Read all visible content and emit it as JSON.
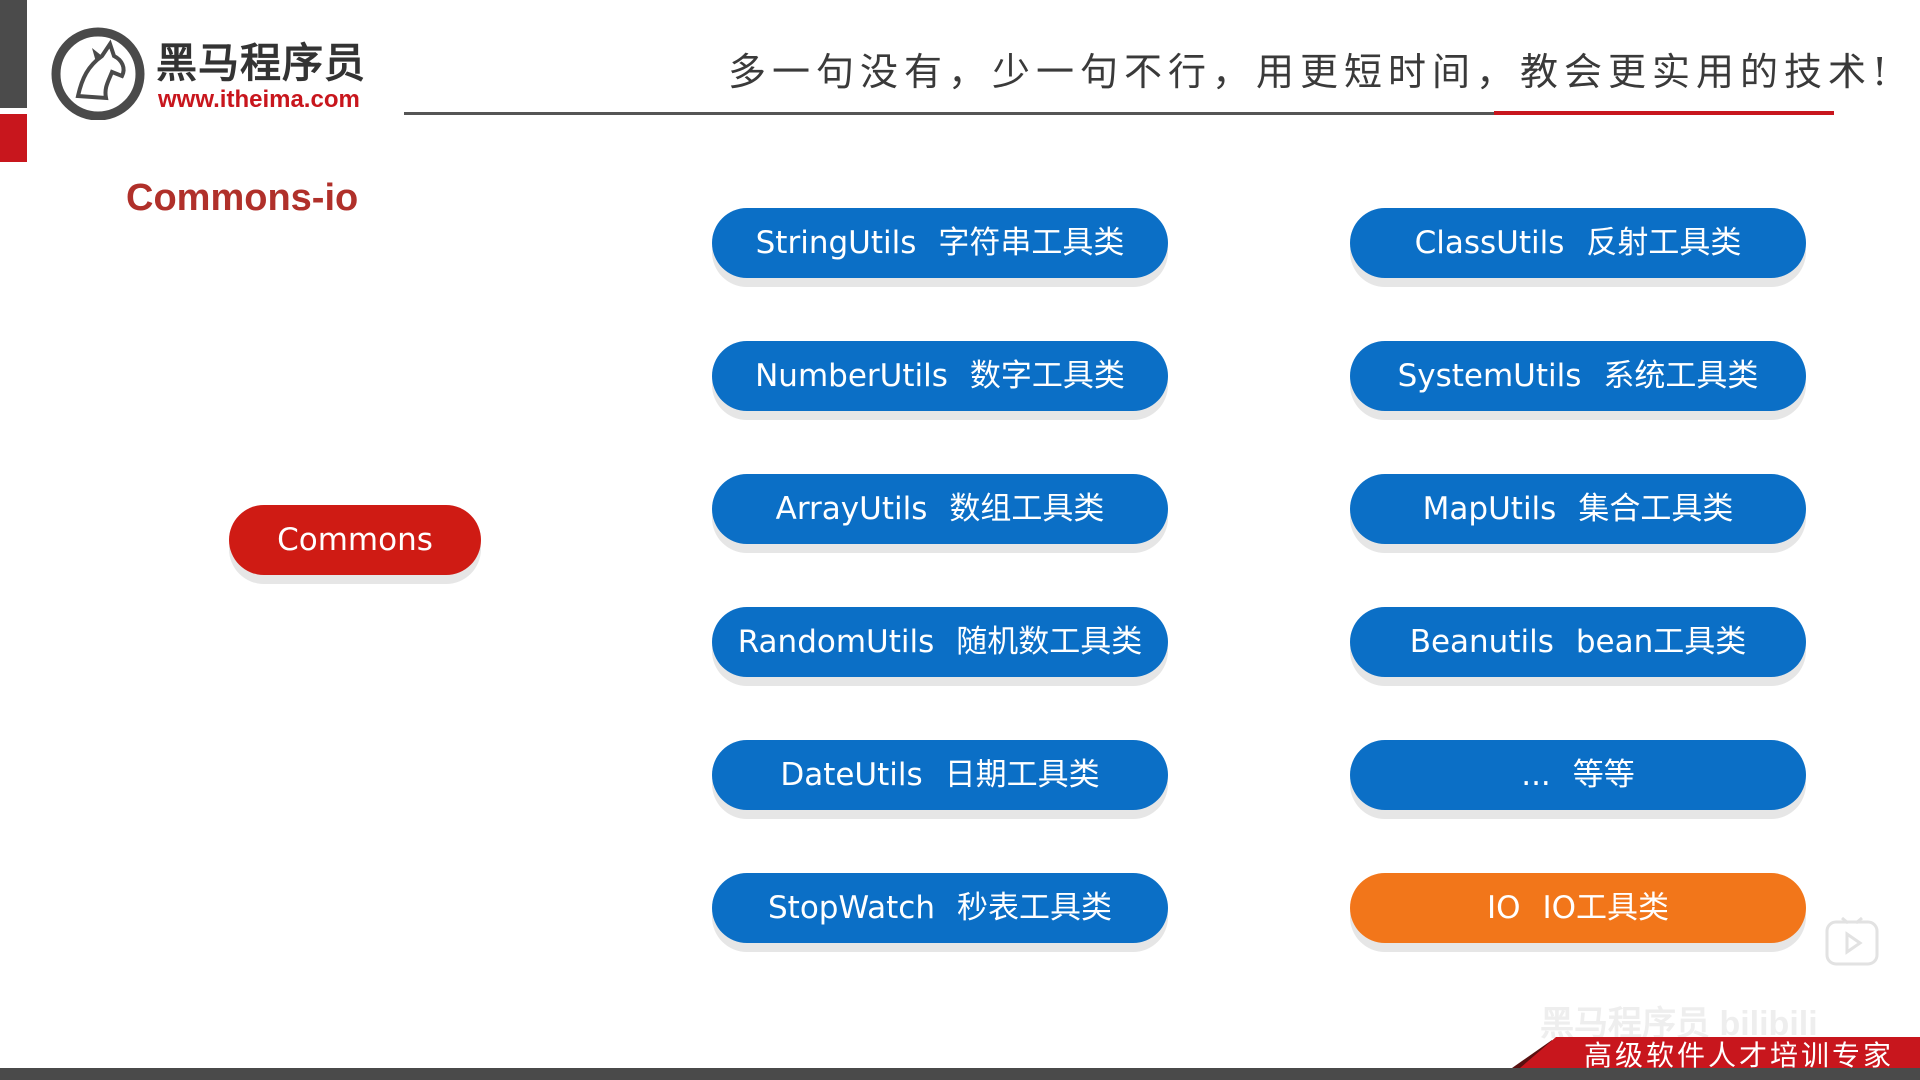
{
  "logo": {
    "name": "黑马程序员",
    "url": "www.itheima.com",
    "logo_icon": "horse-head-logo-icon"
  },
  "header": {
    "slogan": "多一句没有，少一句不行，用更短时间，教会更实用的技术!"
  },
  "page": {
    "title": "Commons-io"
  },
  "root_node": {
    "label": "Commons"
  },
  "left_column": [
    {
      "name": "StringUtils",
      "desc": "字符串工具类"
    },
    {
      "name": "NumberUtils",
      "desc": "数字工具类"
    },
    {
      "name": "ArrayUtils",
      "desc": "数组工具类"
    },
    {
      "name": "RandomUtils",
      "desc": "随机数工具类"
    },
    {
      "name": "DateUtils",
      "desc": "日期工具类"
    },
    {
      "name": "StopWatch",
      "desc": "秒表工具类"
    }
  ],
  "right_column": [
    {
      "name": "ClassUtils",
      "desc": "反射工具类"
    },
    {
      "name": "SystemUtils",
      "desc": "系统工具类"
    },
    {
      "name": "MapUtils",
      "desc": "集合工具类"
    },
    {
      "name": "Beanutils",
      "desc": "bean工具类"
    },
    {
      "name": "...",
      "desc": "等等"
    },
    {
      "name": "IO",
      "desc": "IO工具类"
    }
  ],
  "footer": {
    "tagline": "高级软件人才培训专家"
  },
  "watermark": {
    "text": "黑马程序员 bilibili",
    "icon": "play-icon"
  },
  "colors": {
    "blue_pill": "#0b6fc6",
    "red_pill": "#cf1b14",
    "orange_pill": "#f2761a",
    "brand_red": "#c8161d",
    "title_red": "#b0302a"
  }
}
